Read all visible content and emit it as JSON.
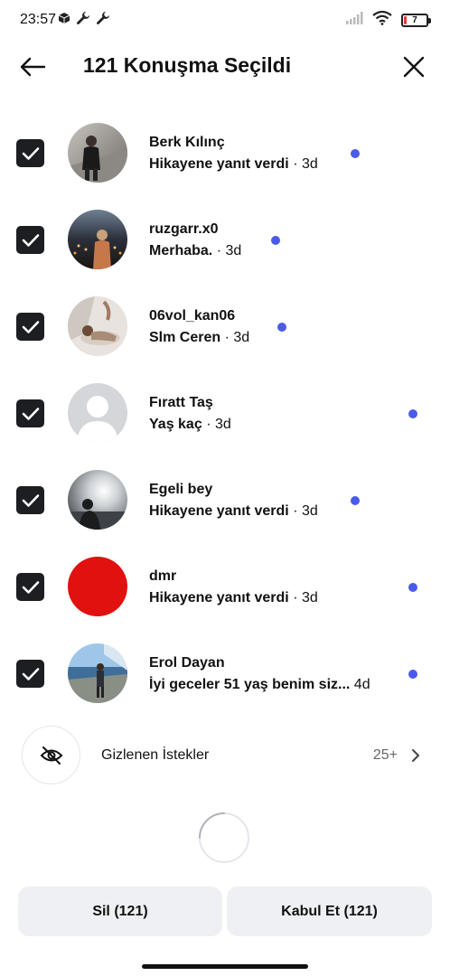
{
  "status": {
    "time": "23:57",
    "battery": "7"
  },
  "header": {
    "title": "121 Konuşma Seçildi"
  },
  "conversations": [
    {
      "name": "Berk Kılınç",
      "message": "Hikayene yanıt verdi",
      "time": "· 3d",
      "unread": true
    },
    {
      "name": "ruzgarr.x0",
      "message": "Merhaba.",
      "time": "· 3d",
      "unread": true
    },
    {
      "name": "06vol_kan06",
      "message": "Slm Ceren",
      "time": "· 3d",
      "unread": true
    },
    {
      "name": "Fıratt Taş",
      "message": "Yaş kaç",
      "time": "· 3d",
      "unread": true
    },
    {
      "name": "Egeli bey",
      "message": "Hikayene yanıt verdi",
      "time": "· 3d",
      "unread": true
    },
    {
      "name": "dmr",
      "message": "Hikayene yanıt verdi",
      "time": "· 3d",
      "unread": true
    },
    {
      "name": "Erol Dayan",
      "message": "İyi geceler 51 yaş benim siz...",
      "time": "4d",
      "unread": true
    }
  ],
  "hidden_requests": {
    "label": "Gizlenen İstekler",
    "count": "25+"
  },
  "actions": {
    "delete_label": "Sil (121)",
    "accept_label": "Kabul Et (121)"
  },
  "colors": {
    "unread_dot": "#4a5bea",
    "checkbox": "#1c1e21",
    "button_bg": "#eff0f3",
    "avatar_dmr": "#e0110f"
  }
}
